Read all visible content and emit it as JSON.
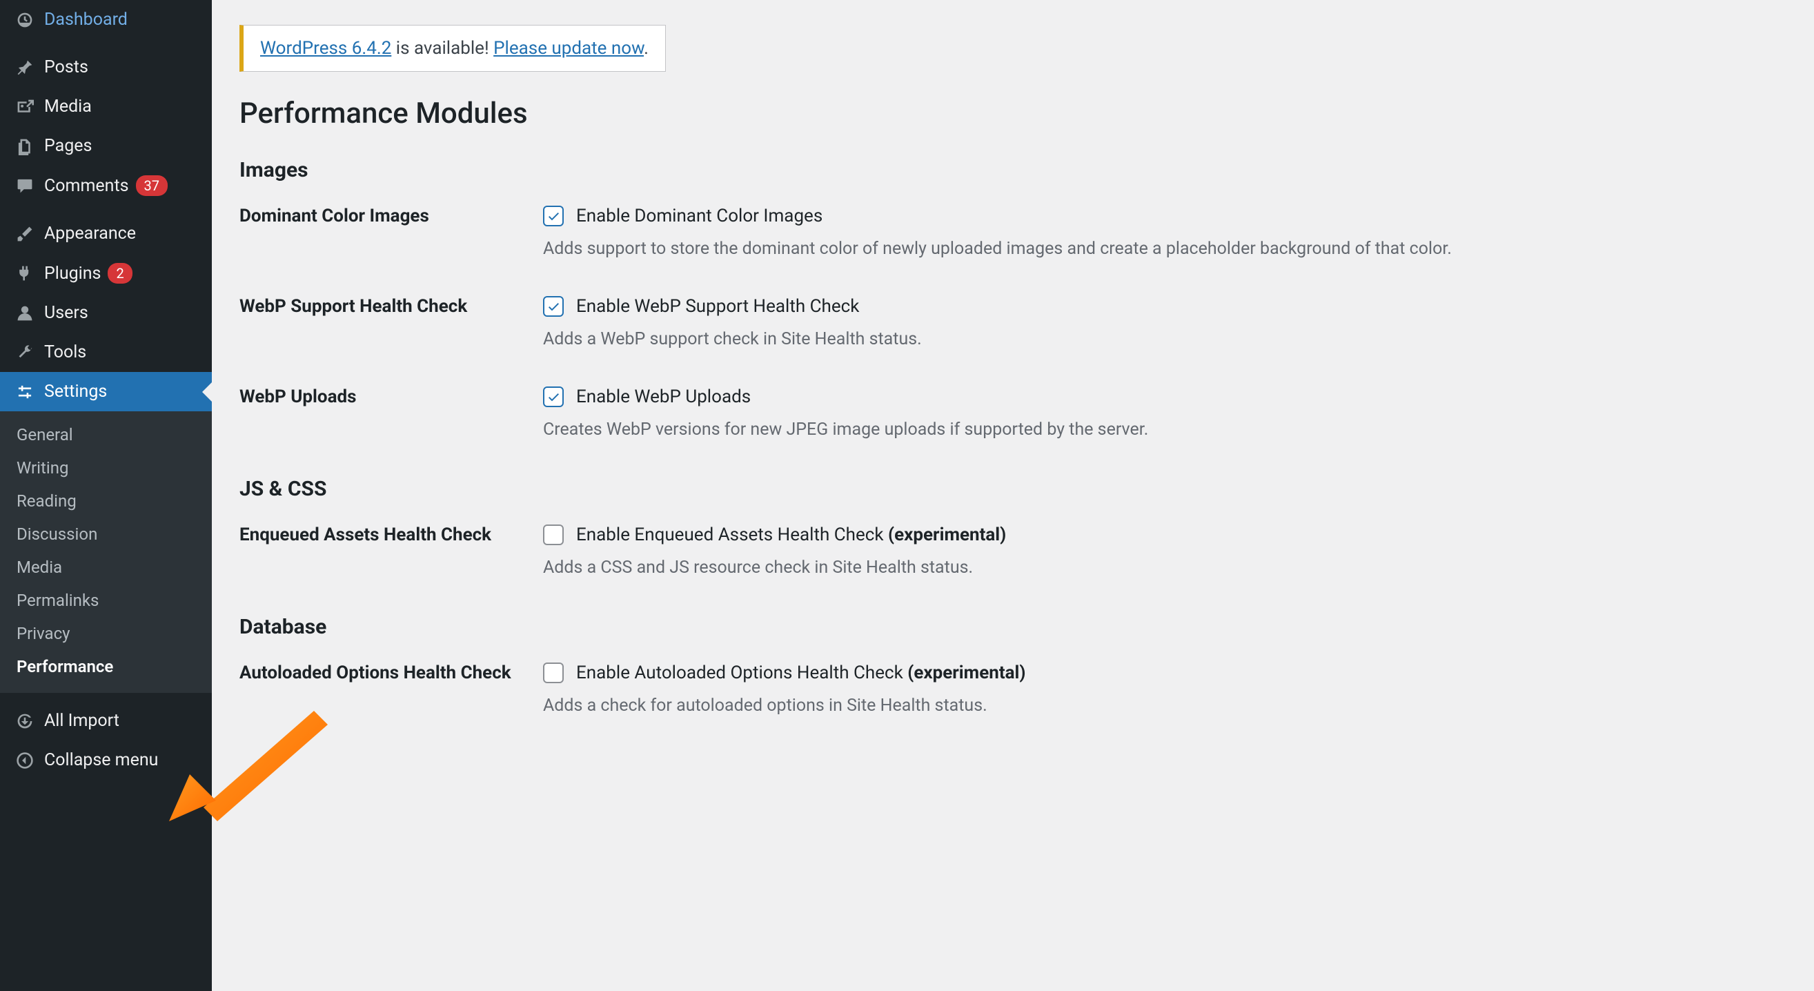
{
  "sidebar": {
    "items": [
      {
        "label": "Dashboard",
        "icon": "dashboard"
      },
      {
        "label": "Posts",
        "icon": "pin"
      },
      {
        "label": "Media",
        "icon": "media"
      },
      {
        "label": "Pages",
        "icon": "pages"
      },
      {
        "label": "Comments",
        "icon": "comment",
        "badge": "37"
      },
      {
        "label": "Appearance",
        "icon": "brush"
      },
      {
        "label": "Plugins",
        "icon": "plug",
        "badge": "2"
      },
      {
        "label": "Users",
        "icon": "user"
      },
      {
        "label": "Tools",
        "icon": "wrench"
      },
      {
        "label": "Settings",
        "icon": "sliders",
        "current": true
      },
      {
        "label": "All Import",
        "icon": "import"
      },
      {
        "label": "Collapse menu",
        "icon": "collapse"
      }
    ],
    "settings_submenu": [
      "General",
      "Writing",
      "Reading",
      "Discussion",
      "Media",
      "Permalinks",
      "Privacy",
      "Performance"
    ],
    "settings_submenu_current": "Performance"
  },
  "notice": {
    "link1": "WordPress 6.4.2",
    "mid": " is available! ",
    "link2": "Please update now",
    "end": "."
  },
  "page_title": "Performance Modules",
  "sections": {
    "images": {
      "title": "Images",
      "dominant": {
        "label": "Dominant Color Images",
        "check_label": "Enable Dominant Color Images",
        "desc": "Adds support to store the dominant color of newly uploaded images and create a placeholder background of that color.",
        "checked": true
      },
      "webp_health": {
        "label": "WebP Support Health Check",
        "check_label": "Enable WebP Support Health Check",
        "desc": "Adds a WebP support check in Site Health status.",
        "checked": true
      },
      "webp_uploads": {
        "label": "WebP Uploads",
        "check_label": "Enable WebP Uploads",
        "desc": "Creates WebP versions for new JPEG image uploads if supported by the server.",
        "checked": true
      }
    },
    "jscss": {
      "title": "JS & CSS",
      "enqueued": {
        "label": "Enqueued Assets Health Check",
        "check_label_text": "Enable Enqueued Assets Health Check ",
        "check_label_exp": "(experimental)",
        "desc": "Adds a CSS and JS resource check in Site Health status.",
        "checked": false
      }
    },
    "database": {
      "title": "Database",
      "autoloaded": {
        "label": "Autoloaded Options Health Check",
        "check_label_text": "Enable Autoloaded Options Health Check ",
        "check_label_exp": "(experimental)",
        "desc": "Adds a check for autoloaded options in Site Health status.",
        "checked": false
      }
    }
  }
}
